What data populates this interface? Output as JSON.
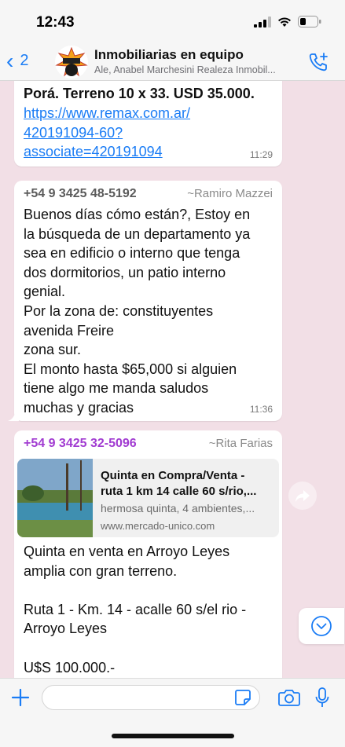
{
  "status": {
    "time": "12:43"
  },
  "header": {
    "back_count": "2",
    "title": "Inmobiliarias en equipo",
    "subtitle": "Ale, Anabel Marchesini Realeza Inmobil..."
  },
  "messages": [
    {
      "lines": [
        "Porá. Terreno 10 x 33. USD 35.000."
      ],
      "link_lines": [
        "https://www.remax.com.ar/",
        "420191094-60?",
        "associate=420191094"
      ],
      "time": "11:29"
    },
    {
      "sender_phone": "+54 9 3425 48-5192",
      "sender_name": "~Ramiro Mazzei",
      "sender_color": "#5b5b5b",
      "lines": [
        "Buenos días cómo están?, Estoy en",
        "la búsqueda de un departamento ya",
        "sea en edificio o interno que tenga",
        "dos dormitorios, un patio interno",
        "genial.",
        "Por la zona de: constituyentes",
        "avenida Freire",
        "zona sur.",
        "El monto hasta $65,000 si alguien",
        "tiene algo me manda saludos",
        "muchas y gracias"
      ],
      "time": "11:36"
    },
    {
      "sender_phone": "+54 9 3425 32-5096",
      "sender_name": "~Rita Farias",
      "sender_color": "#a13bd1",
      "preview": {
        "title_1": "Quinta en Compra/Venta -",
        "title_2": "ruta 1 km 14 calle 60 s/rio,...",
        "desc": "hermosa quinta, 4 ambientes,...",
        "url": "www.mercado-unico.com"
      },
      "lines": [
        "Quinta en venta en Arroyo Leyes",
        "amplia con gran terreno.",
        "",
        "Ruta 1 - Km. 14 - acalle 60 s/el rio -",
        "Arroyo Leyes",
        "",
        "U$S 100.000.-"
      ]
    }
  ],
  "input": {
    "placeholder": ""
  },
  "colors": {
    "accent": "#1a7cf5",
    "chat_bg": "#f2dfe6"
  }
}
